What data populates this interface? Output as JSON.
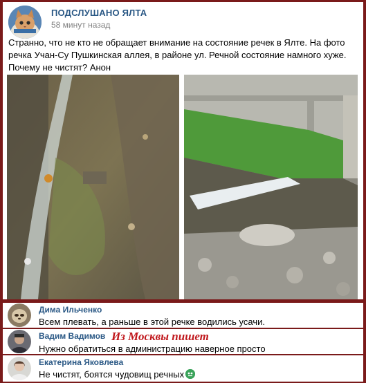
{
  "post": {
    "group_name": "ПОДСЛУШАНО ЯЛТА",
    "time": "58 минут назад",
    "text": "Странно, что не кто не обращает внимание на состояние речек в Ялте. На фото речка Учан-Су Пушкинская аллея, в районе ул. Речной состояние намного хуже. Почему не чистят? Анон"
  },
  "overlay": {
    "title": "Из Москвы пишет"
  },
  "comments": [
    {
      "author": "Дима Ильченко",
      "text": "Всем плевать, а раньше в этой речке водились усачи."
    },
    {
      "author": "Вадим Вадимов",
      "text": "Нужно обратиться в администрацию наверное просто"
    },
    {
      "author": "Екатерина Яковлева",
      "text": "Не чистят, боятся чудовищ речных",
      "emoji": "monster-emoji-icon"
    }
  ],
  "colors": {
    "background": "#7a1a1a",
    "link": "#2a5885",
    "overlay_text": "#c0181d"
  }
}
